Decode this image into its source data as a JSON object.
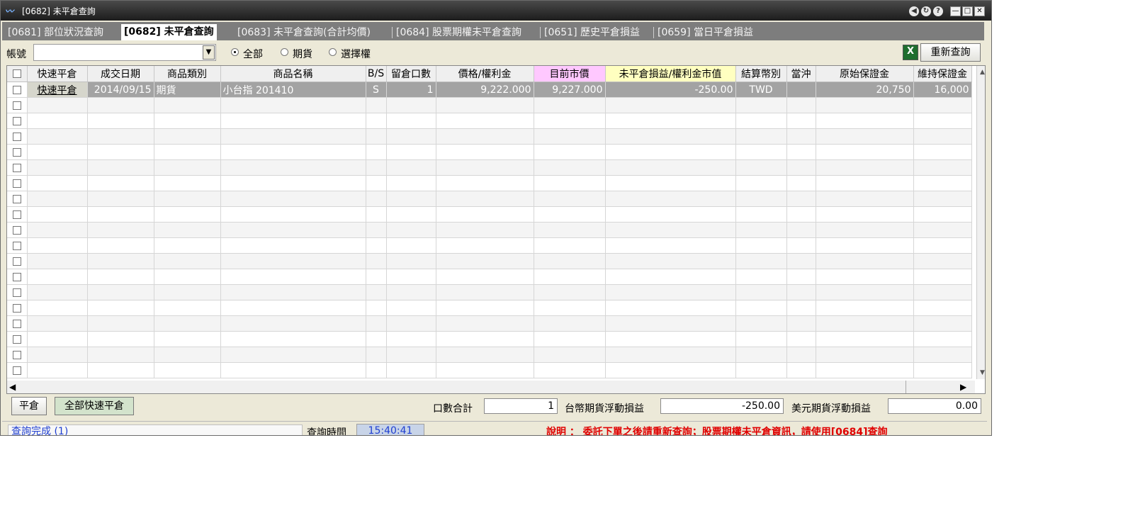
{
  "window": {
    "title": "[0682] 未平倉查詢"
  },
  "tabs": [
    {
      "label": "[0681] 部位狀況查詢"
    },
    {
      "label": "[0682] 未平倉查詢"
    },
    {
      "label": "[0683] 未平倉查詢(合計均價)"
    },
    {
      "label": "[0684] 股票期權未平倉查詢"
    },
    {
      "label": "[0651] 歷史平倉損益"
    },
    {
      "label": "[0659] 當日平倉損益"
    }
  ],
  "toolbar": {
    "account_label": "帳號",
    "account_value": "",
    "filter_options": [
      "全部",
      "期貨",
      "選擇權"
    ],
    "filter_selected": "全部",
    "requery_label": "重新查詢"
  },
  "grid": {
    "columns": [
      "快速平倉",
      "成交日期",
      "商品類別",
      "商品名稱",
      "B/S",
      "留倉口數",
      "價格/權利金",
      "目前市價",
      "未平倉損益/權利金市值",
      "結算幣別",
      "當沖",
      "原始保證金",
      "維持保證金"
    ],
    "rows": [
      {
        "quick": "快速平倉",
        "date": "2014/09/15",
        "category": "期貨",
        "name": "小台指 201410",
        "bs": "S",
        "qty": "1",
        "price": "9,222.000",
        "market": "9,227.000",
        "pnl": "-250.00",
        "currency": "TWD",
        "daytrade": "",
        "init_margin": "20,750",
        "maint_margin": "16,000"
      }
    ],
    "empty_rows": 18
  },
  "bottom": {
    "close_label": "平倉",
    "quick_close_all_label": "全部快速平倉",
    "qty_total_label": "口數合計",
    "qty_total_value": "1",
    "twd_pnl_label": "台幣期貨浮動損益",
    "twd_pnl_value": "-250.00",
    "usd_pnl_label": "美元期貨浮動損益",
    "usd_pnl_value": "0.00"
  },
  "status": {
    "message": "查詢完成 (1)",
    "time_label": "查詢時間",
    "time_value": "15:40:41",
    "note": "說明 ： 委託下單之後請重新查詢；股票期權未平倉資訊，請使用[0684]查詢"
  },
  "colors": {
    "market_header": "#ffc8ff",
    "pnl_header": "#ffffc0",
    "note": "#e00000",
    "status_text": "#1f3fd0"
  }
}
